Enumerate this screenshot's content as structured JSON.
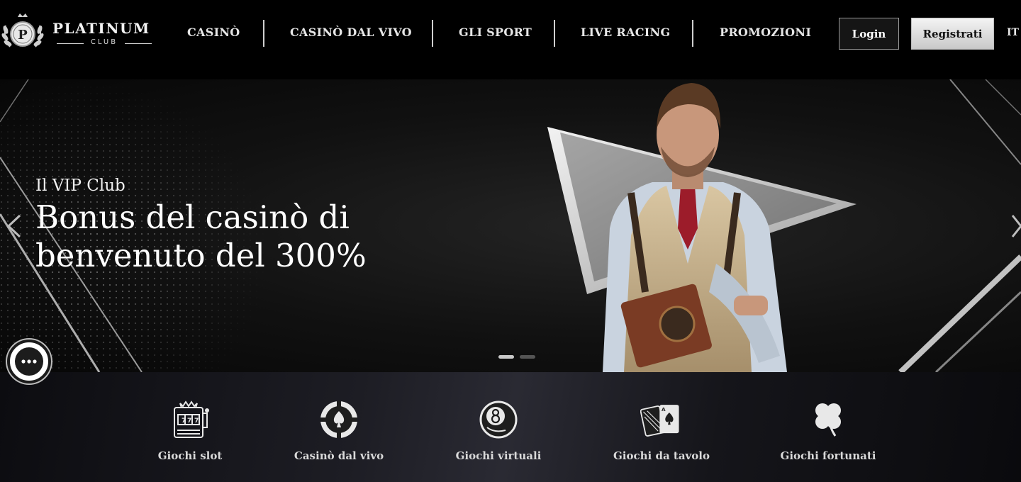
{
  "header": {
    "logo": {
      "title": "PLATINUM",
      "subtitle": "CLUB",
      "emblem_letter": "P"
    },
    "nav": [
      {
        "label": "CASINÒ"
      },
      {
        "label": "CASINÒ DAL VIVO"
      },
      {
        "label": "GLI SPORT"
      },
      {
        "label": "LIVE RACING"
      },
      {
        "label": "PROMOZIONI"
      }
    ],
    "login_label": "Login",
    "register_label": "Registrati",
    "language": "IT"
  },
  "hero": {
    "subtitle": "Il VIP Club",
    "title_line1": "Bonus del casinò di",
    "title_line2": "benvenuto del 300%",
    "slide_count": 2,
    "active_slide": 1,
    "icons": {
      "prev": "chevron-left-icon",
      "next": "chevron-right-icon",
      "chat": "chat-bubble-icon"
    }
  },
  "categories": [
    {
      "label": "Giochi slot",
      "icon": "slot-machine-icon"
    },
    {
      "label": "Casinò dal vivo",
      "icon": "poker-chip-icon"
    },
    {
      "label": "Giochi virtuali",
      "icon": "eight-ball-icon"
    },
    {
      "label": "Giochi da tavolo",
      "icon": "playing-cards-icon"
    },
    {
      "label": "Giochi fortunati",
      "icon": "four-leaf-clover-icon"
    }
  ],
  "colors": {
    "background": "#000000",
    "text": "#ffffff",
    "nav_text": "#e6e6e6",
    "register_button": "#e0e0e0",
    "login_border": "#9a9a9a"
  }
}
